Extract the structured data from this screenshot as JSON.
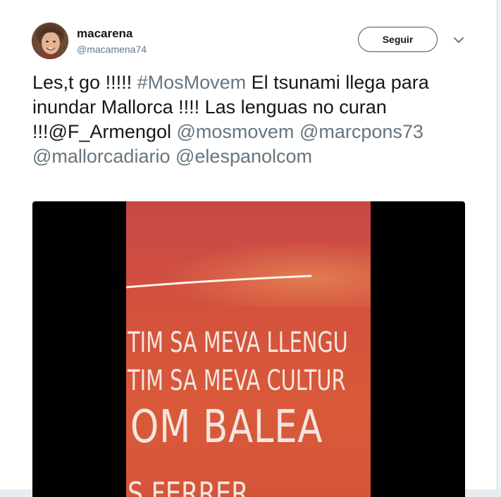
{
  "tweet": {
    "display_name": "macarena",
    "handle": "@macamena74",
    "follow_label": "Seguir",
    "text_parts": {
      "p1": "Les,t go !!!!! ",
      "hashtag": "#MosMovem",
      "p2": " El tsunami llega para inundar Mallorca !!!! Las lenguas no curan !!!@F_Armengol ",
      "m1": "@mosmovem",
      "m2": "@marcpons73",
      "m3": "@mallorcadiario",
      "m4": "@elespanolcom"
    },
    "link_color": "#66757f"
  },
  "media": {
    "lines": [
      "TIM SA MEVA LLENGU",
      "TIM SA MEVA CULTUR",
      "OM BALEA",
      "S FERRER"
    ]
  },
  "icons": {
    "avatar": "user-avatar-photo",
    "caret": "chevron-down-icon"
  }
}
